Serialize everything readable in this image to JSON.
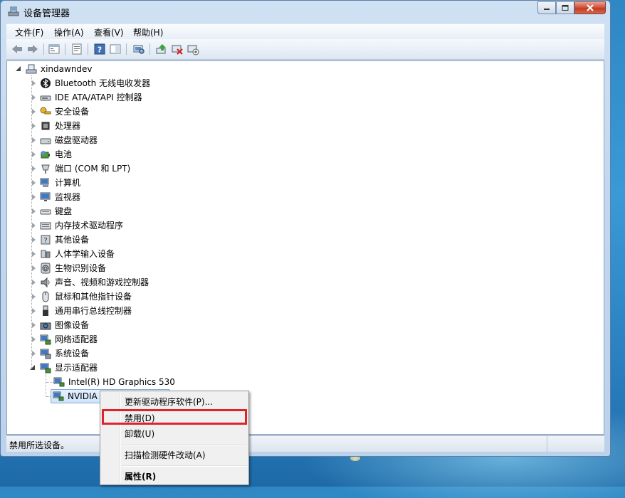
{
  "window": {
    "title": "设备管理器"
  },
  "menu": [
    {
      "label": "文件(F)"
    },
    {
      "label": "操作(A)"
    },
    {
      "label": "查看(V)"
    },
    {
      "label": "帮助(H)"
    }
  ],
  "tree": {
    "root": "xindawndev",
    "categories": [
      {
        "label": "Bluetooth 无线电收发器",
        "icon": "bluetooth-icon"
      },
      {
        "label": "IDE ATA/ATAPI 控制器",
        "icon": "ide-controller-icon"
      },
      {
        "label": "安全设备",
        "icon": "security-key-icon"
      },
      {
        "label": "处理器",
        "icon": "processor-icon"
      },
      {
        "label": "磁盘驱动器",
        "icon": "disk-drive-icon"
      },
      {
        "label": "电池",
        "icon": "battery-icon"
      },
      {
        "label": "端口 (COM 和 LPT)",
        "icon": "port-icon"
      },
      {
        "label": "计算机",
        "icon": "computer-icon"
      },
      {
        "label": "监视器",
        "icon": "monitor-icon"
      },
      {
        "label": "键盘",
        "icon": "keyboard-icon"
      },
      {
        "label": "内存技术驱动程序",
        "icon": "memory-icon"
      },
      {
        "label": "其他设备",
        "icon": "other-device-icon"
      },
      {
        "label": "人体学输入设备",
        "icon": "hid-icon"
      },
      {
        "label": "生物识别设备",
        "icon": "fingerprint-icon"
      },
      {
        "label": "声音、视频和游戏控制器",
        "icon": "speaker-icon"
      },
      {
        "label": "鼠标和其他指针设备",
        "icon": "mouse-icon"
      },
      {
        "label": "通用串行总线控制器",
        "icon": "usb-icon"
      },
      {
        "label": "图像设备",
        "icon": "camera-icon"
      },
      {
        "label": "网络适配器",
        "icon": "network-adapter-icon"
      },
      {
        "label": "系统设备",
        "icon": "system-device-icon"
      },
      {
        "label": "显示适配器",
        "icon": "display-adapter-icon"
      }
    ],
    "display_children": [
      {
        "label": "Intel(R) HD Graphics 530"
      },
      {
        "label": "NVIDIA"
      }
    ]
  },
  "context_menu": {
    "items": [
      {
        "label": "更新驱动程序软件(P)..."
      },
      {
        "label": "禁用(D)"
      },
      {
        "label": "卸载(U)"
      },
      {
        "label": "扫描检测硬件改动(A)"
      },
      {
        "label": "属性(R)"
      }
    ]
  },
  "status": {
    "text": "禁用所选设备。"
  },
  "colors": {
    "highlight_border": "#e0232b",
    "selection": "#cfe4fa"
  }
}
